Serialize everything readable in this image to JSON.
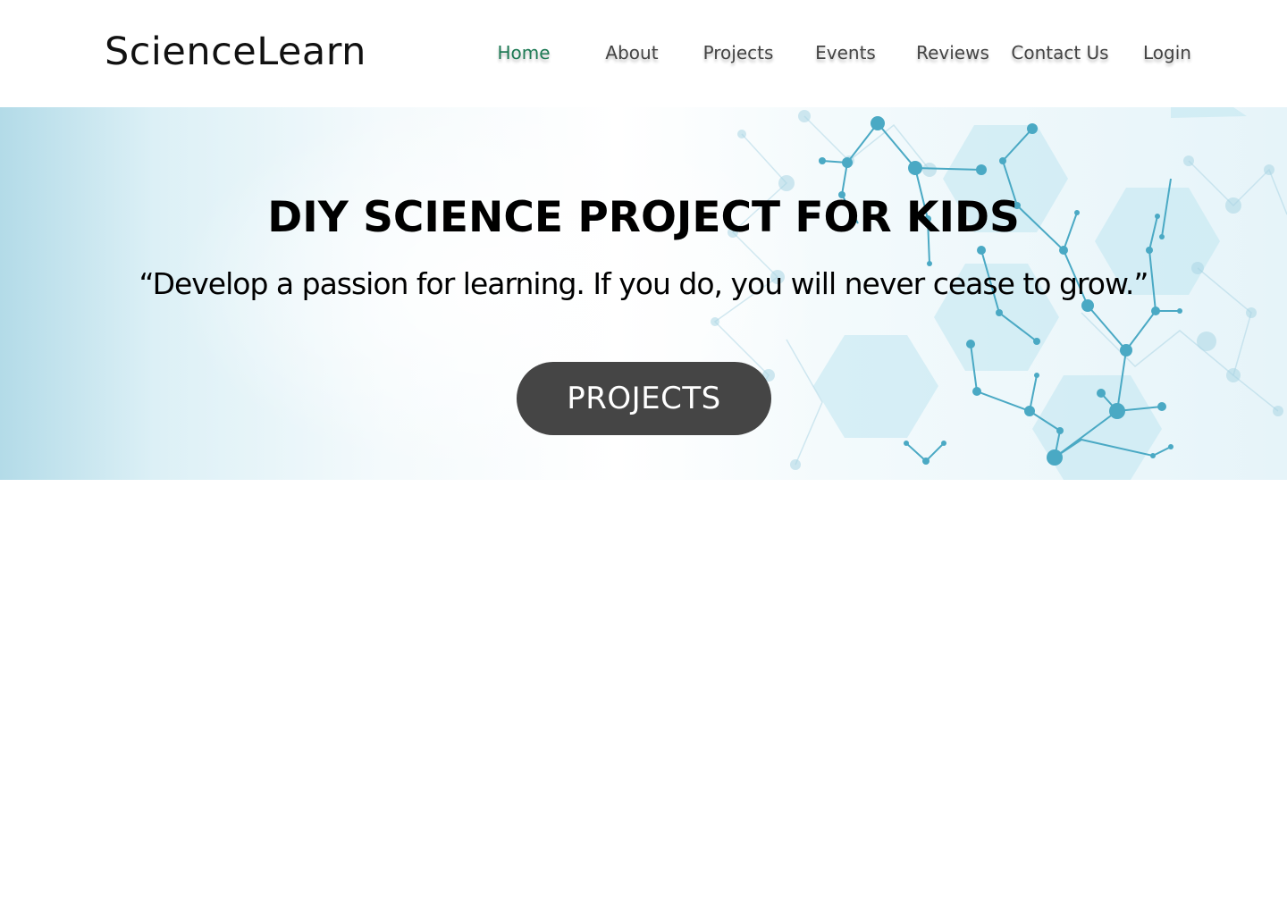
{
  "header": {
    "brand": "ScienceLearn",
    "nav": [
      {
        "label": "Home",
        "active": true
      },
      {
        "label": "About",
        "active": false
      },
      {
        "label": "Projects",
        "active": false
      },
      {
        "label": "Events",
        "active": false
      },
      {
        "label": "Reviews",
        "active": false
      },
      {
        "label": "Contact Us",
        "active": false
      },
      {
        "label": "Login",
        "active": false
      }
    ]
  },
  "hero": {
    "title": "DIY SCIENCE PROJECT FOR KIDS",
    "quote": "“Develop a passion for learning. If you do, you will never cease to grow.”",
    "cta_label": "PROJECTS",
    "background_image": "molecule-network-illustration"
  },
  "colors": {
    "nav_active": "#1e7a55",
    "nav_text": "#444444",
    "cta_background": "#454545",
    "cta_text": "#ffffff",
    "molecule_accent": "#4aa9c4"
  }
}
